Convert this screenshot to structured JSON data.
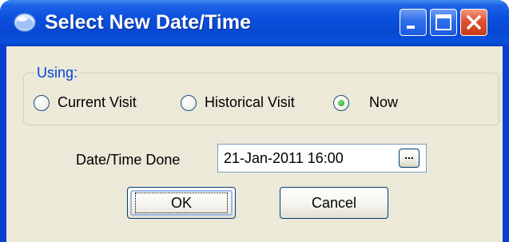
{
  "window": {
    "title": "Select New Date/Time",
    "titlebar_color": "#0a4fdc",
    "close_color": "#e0512e"
  },
  "using_group": {
    "legend": "Using:",
    "options": [
      {
        "label": "Current Visit",
        "selected": false
      },
      {
        "label": "Historical Visit",
        "selected": false
      },
      {
        "label": "Now",
        "selected": true
      }
    ]
  },
  "date_field": {
    "label": "Date/Time Done",
    "value": "21-Jan-2011 16:00",
    "browse_button_label": "..."
  },
  "buttons": {
    "ok_label": "OK",
    "cancel_label": "Cancel"
  }
}
